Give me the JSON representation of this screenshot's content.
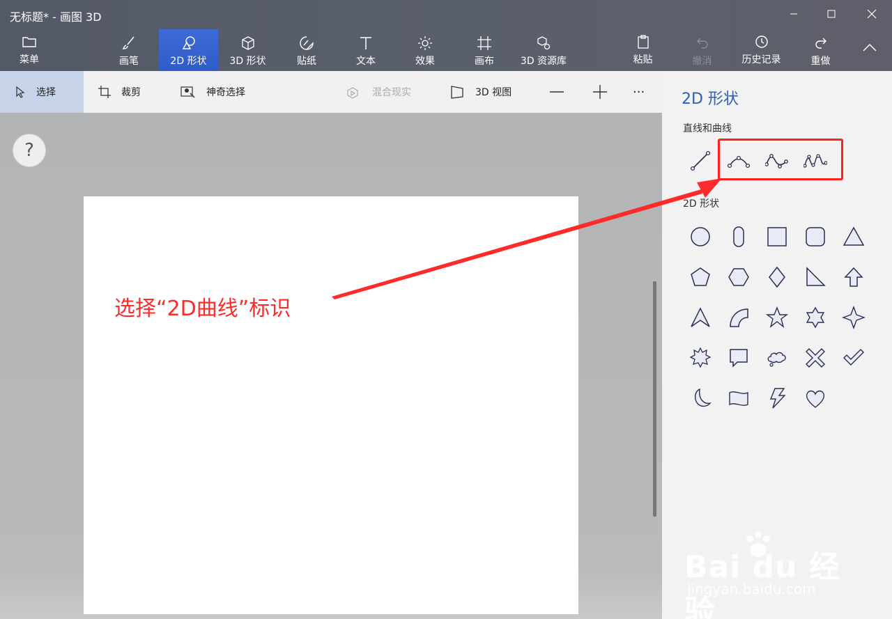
{
  "window": {
    "title": "无标题* - 画图 3D"
  },
  "ribbon": {
    "tabs": [
      {
        "label": "菜单"
      },
      {
        "label": "画笔"
      },
      {
        "label": "2D 形状"
      },
      {
        "label": "3D 形状"
      },
      {
        "label": "贴纸"
      },
      {
        "label": "文本"
      },
      {
        "label": "效果"
      },
      {
        "label": "画布"
      },
      {
        "label": "3D 资源库"
      },
      {
        "label": "粘贴"
      },
      {
        "label": "撤消"
      },
      {
        "label": "历史记录"
      },
      {
        "label": "重做"
      }
    ],
    "active_tab": "2D 形状"
  },
  "toolbar": {
    "select": "选择",
    "crop": "裁剪",
    "magic_select": "神奇选择",
    "mixed_reality": "混合现实",
    "view3d": "3D 视图",
    "more": "···"
  },
  "help": {
    "label": "?"
  },
  "panel": {
    "title": "2D 形状",
    "lines_section": "直线和曲线",
    "shapes_section": "2D 形状",
    "icons_lines": [
      "line-icon",
      "curve-2pt-icon",
      "curve-3pt-icon",
      "curve-4pt-icon"
    ],
    "icons_shapes": [
      "circle-icon",
      "capsule-icon",
      "square-icon",
      "rounded-square-icon",
      "triangle-icon",
      "pentagon-icon",
      "hexagon-icon",
      "diamond-icon",
      "right-triangle-icon",
      "arrow-up-icon",
      "arrowhead-icon",
      "quarter-circle-icon",
      "star5-icon",
      "star6-icon",
      "star4-icon",
      "burst-icon",
      "speech-bubble-icon",
      "thought-bubble-icon",
      "x-mark-icon",
      "checkmark-icon",
      "moon-icon",
      "banner-icon",
      "lightning-icon",
      "heart-icon"
    ]
  },
  "annotation": {
    "text": "选择“2D曲线”标识",
    "color": "#ff2a2a"
  },
  "watermark": {
    "brand": "Bai du 经验",
    "url": "jingyan.baidu.com"
  },
  "colors": {
    "accent": "#2f5cc9",
    "panel_title": "#2b5fb8",
    "highlight": "#ff2020"
  }
}
